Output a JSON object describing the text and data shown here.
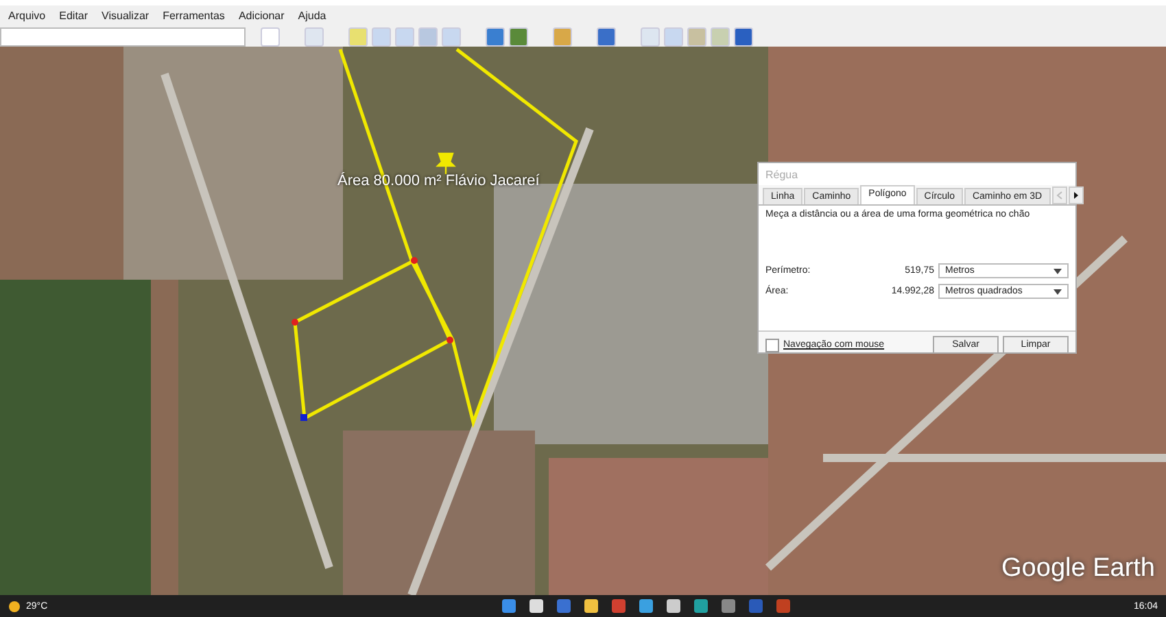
{
  "menu": [
    {
      "label": "Arquivo"
    },
    {
      "label": "Editar"
    },
    {
      "label": "Visualizar"
    },
    {
      "label": "Ferramentas"
    },
    {
      "label": "Adicionar"
    },
    {
      "label": "Ajuda"
    }
  ],
  "map": {
    "placemark": {
      "label": "Área 80.000 m² Flávio Jacareí"
    },
    "logo": "Google Earth"
  },
  "ruler_dialog": {
    "title": "Régua",
    "tabs": [
      {
        "label": "Linha",
        "selected": false
      },
      {
        "label": "Caminho",
        "selected": false
      },
      {
        "label": "Polígono",
        "selected": true
      },
      {
        "label": "Círculo",
        "selected": false
      },
      {
        "label": "Caminho em 3D",
        "selected": false
      }
    ],
    "description": "Meça a distância ou a área de uma forma geométrica no chão",
    "measurements": [
      {
        "label": "Perímetro:",
        "value": "519,75",
        "unit": "Metros"
      },
      {
        "label": "Área:",
        "value": "14.992,28",
        "unit": "Metros quadrados"
      }
    ],
    "mouse_navigation": {
      "label": "Navegação com mouse",
      "checked": false
    },
    "buttons": [
      "Salvar",
      "Limpar"
    ]
  },
  "taskbar": {
    "weather": "29°C",
    "clock": "16:04"
  }
}
